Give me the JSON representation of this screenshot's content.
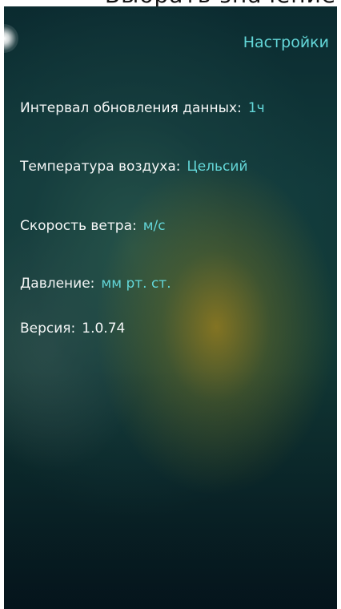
{
  "header": {
    "cut_title": "Выбрать значение"
  },
  "nav": {
    "settings_label": "Настройки"
  },
  "settings": {
    "update_interval": {
      "label": "Интервал обновления данных:",
      "value": "1ч"
    },
    "air_temperature": {
      "label": "Температура воздуха:",
      "value": "Цельсий"
    },
    "wind_speed": {
      "label": "Скорость ветра:",
      "value": "м/с"
    },
    "pressure": {
      "label": "Давление:",
      "value": "мм рт. ст."
    },
    "version": {
      "label": "Версия:",
      "value": "1.0.74"
    }
  },
  "colors": {
    "accent": "#63d6d8",
    "text": "#f4f6f6"
  }
}
